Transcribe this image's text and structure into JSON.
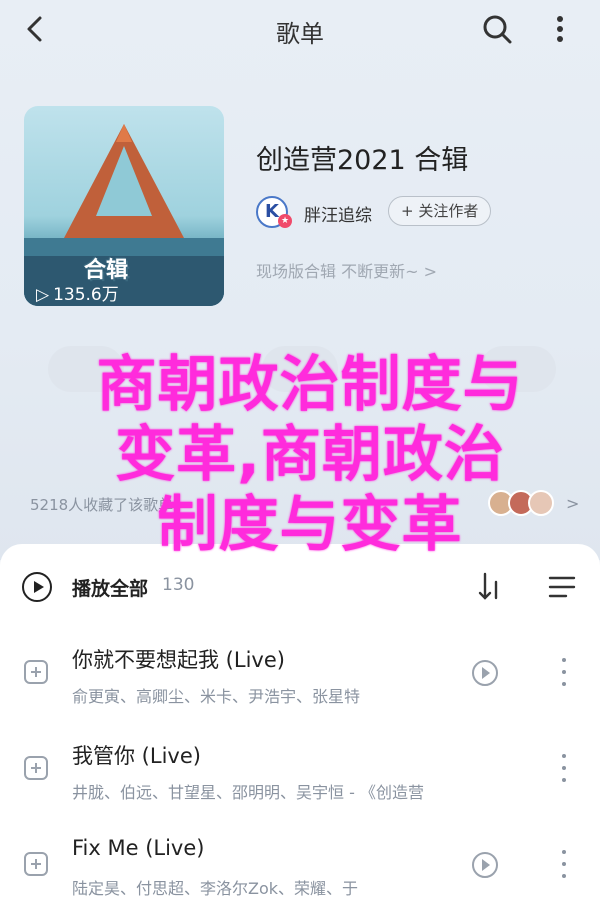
{
  "header": {
    "title": "歌单"
  },
  "album": {
    "cover_label": "合辑",
    "play_count": "135.6万",
    "title": "创造营2021 合辑",
    "artist_avatar_letter": "K",
    "artist_name": "胖汪追综",
    "follow_label": "+ 关注作者",
    "description": "现场版合辑 不断更新~ >"
  },
  "actions": {
    "collect_text": "5218人收藏了该歌单",
    "collect_arrow": ">"
  },
  "overlay": {
    "line1": "商朝政治制度与",
    "line2": "变革,商朝政治",
    "line3": "制度与变革"
  },
  "tracklist": {
    "play_all_label": "播放全部",
    "play_all_count": "130",
    "songs": [
      {
        "title": "你就不要想起我 (Live)",
        "artists": "俞更寅、高卿尘、米卡、尹浩宇、张星特"
      },
      {
        "title": "我管你 (Live)",
        "artists": "井胧、伯远、甘望星、邵明明、吴宇恒 - 《创造营"
      },
      {
        "title": "Fix Me (Live)",
        "artists": "陆定昊、付思超、李洛尔Zok、荣耀、于"
      }
    ]
  },
  "colors": {
    "overlay": "#ff2bdc",
    "background": "#eef2f7",
    "accent": "#4a78c8"
  },
  "icons": [
    "back-arrow-icon",
    "search-icon",
    "more-vertical-icon",
    "play-circle-icon",
    "sort-icon",
    "multi-select-icon",
    "add-to-list-icon",
    "mv-play-icon"
  ]
}
